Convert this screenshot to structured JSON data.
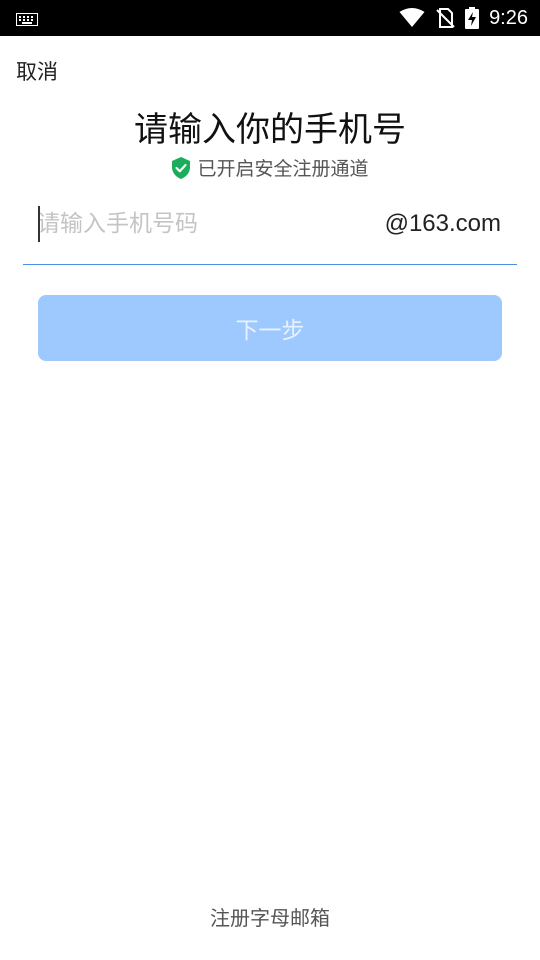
{
  "status_bar": {
    "time": "9:26",
    "icons": [
      "keyboard-icon",
      "wifi-icon",
      "no-sim-icon",
      "battery-charging-icon"
    ]
  },
  "header": {
    "cancel_label": "取消"
  },
  "main": {
    "title": "请输入你的手机号",
    "secure_notice": "已开启安全注册通道",
    "phone_placeholder": "请输入手机号码",
    "phone_value": "",
    "domain_suffix": "@163.com",
    "next_button_label": "下一步"
  },
  "footer": {
    "alt_register_label": "注册字母邮箱"
  },
  "colors": {
    "accent": "#4a90e2",
    "button_disabled": "#9ec9ff",
    "shield_green": "#1aad5a"
  }
}
